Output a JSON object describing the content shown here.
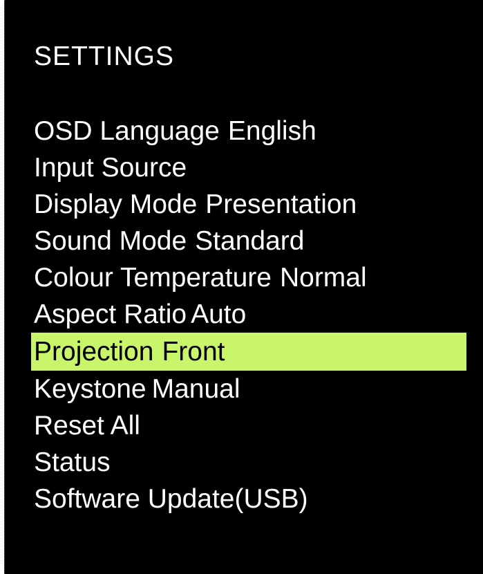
{
  "title": "SETTINGS",
  "highlight_color": "#c8f56a",
  "menu": {
    "items": [
      {
        "label": "OSD Language",
        "value": "English",
        "selected": false
      },
      {
        "label": "Input Source",
        "value": "",
        "selected": false
      },
      {
        "label": "Display Mode",
        "value": "Presentation",
        "selected": false
      },
      {
        "label": "Sound Mode",
        "value": "Standard",
        "selected": false
      },
      {
        "label": "Colour Temperature",
        "value": "Normal",
        "selected": false
      },
      {
        "label": "Aspect Ratio",
        "value": "Auto",
        "selected": false
      },
      {
        "label": "Projection",
        "value": "Front",
        "selected": true
      },
      {
        "label": "Keystone",
        "value": "Manual",
        "selected": false
      },
      {
        "label": "Reset All",
        "value": "",
        "selected": false
      },
      {
        "label": "Status",
        "value": "",
        "selected": false
      },
      {
        "label": "Software Update(USB)",
        "value": "",
        "selected": false
      }
    ]
  }
}
